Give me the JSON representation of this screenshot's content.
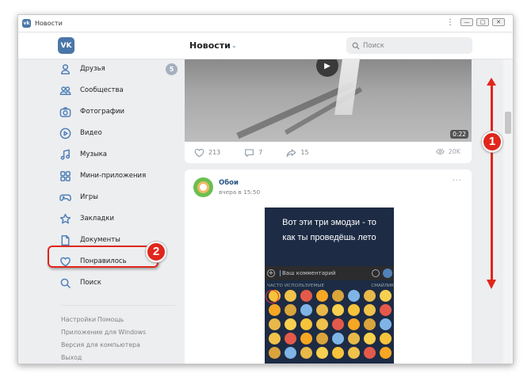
{
  "window": {
    "title": "Новости",
    "logo_letter": "vk",
    "menu_glyph": "⋮",
    "minimize": "—",
    "maximize": "▢",
    "close": "✕"
  },
  "header": {
    "logo_letter": "VK",
    "title": "Новости",
    "title_chevron": "⌄",
    "search_placeholder": "Поиск"
  },
  "sidebar": {
    "items": [
      {
        "label": "Друзья",
        "icon": "user-icon",
        "badge": "5"
      },
      {
        "label": "Сообщества",
        "icon": "users-icon"
      },
      {
        "label": "Фотографии",
        "icon": "camera-icon"
      },
      {
        "label": "Видео",
        "icon": "play-icon"
      },
      {
        "label": "Музыка",
        "icon": "music-icon"
      },
      {
        "label": "Мини-приложения",
        "icon": "apps-icon"
      },
      {
        "label": "Игры",
        "icon": "gamepad-icon"
      },
      {
        "label": "Закладки",
        "icon": "star-icon"
      },
      {
        "label": "Документы",
        "icon": "document-icon"
      },
      {
        "label": "Понравилось",
        "icon": "heart-icon"
      },
      {
        "label": "Поиск",
        "icon": "search-icon"
      }
    ],
    "footer": {
      "settings": "Настройки",
      "help": "Помощь",
      "windows_app": "Приложение для Windows",
      "desktop_version": "Версия для компьютера",
      "logout": "Выход"
    }
  },
  "feed": {
    "post1": {
      "video_duration": "0:22",
      "likes": "213",
      "comments": "7",
      "shares": "15",
      "views": "20K"
    },
    "post2": {
      "author": "Обои",
      "time": "вчера в 15:50",
      "more": "···",
      "image_caption_line1": "Вот эти три эмодзи - то",
      "image_caption_line2": "как ты проведёшь лето",
      "image_input_placeholder": "Ваш комментарий",
      "image_recent_label": "ЧАСТО ИСПОЛЬЗУЕМЫЕ",
      "image_recent_label2": "СМАЙЛИК"
    }
  },
  "annotations": {
    "badge1": "1",
    "badge2": "2",
    "accent_color": "#e1261c"
  },
  "colors": {
    "vk_blue": "#4a76a8",
    "link_blue": "#2a5885",
    "icon_blue": "#5181b8",
    "background": "#edeef0"
  }
}
